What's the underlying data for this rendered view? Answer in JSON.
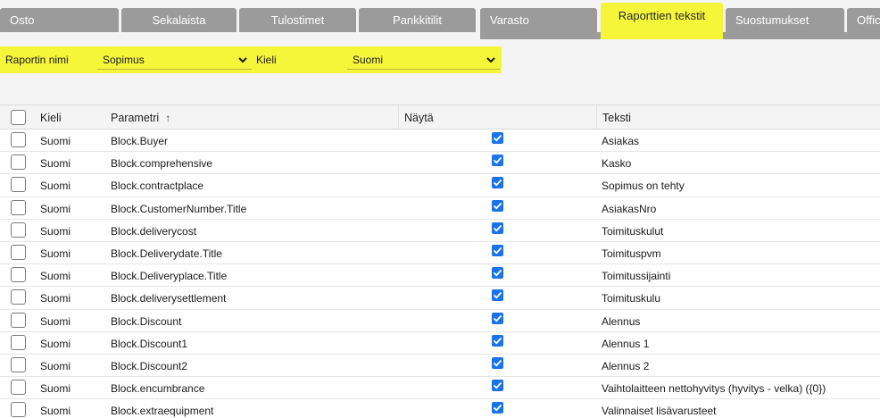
{
  "tabs": [
    {
      "label": "Osto",
      "active": false
    },
    {
      "label": "Sekalaista",
      "active": false
    },
    {
      "label": "Tulostimet",
      "active": false
    },
    {
      "label": "Pankkitilit",
      "active": false
    },
    {
      "label": "Varasto",
      "active": false
    },
    {
      "label": "Raporttien tekstit",
      "active": true
    },
    {
      "label": "Suostumukset",
      "active": false
    },
    {
      "label": "Offic",
      "active": false
    }
  ],
  "filters": {
    "report_label": "Raportin nimi",
    "report_value": "Sopimus",
    "language_label": "Kieli",
    "language_value": "Suomi"
  },
  "table": {
    "columns": {
      "language": "Kieli",
      "parameter": "Parametri",
      "sort_indicator": "↑",
      "show": "Näytä",
      "text": "Teksti"
    },
    "rows": [
      {
        "language": "Suomi",
        "parameter": "Block.Buyer",
        "show": true,
        "text": "Asiakas"
      },
      {
        "language": "Suomi",
        "parameter": "Block.comprehensive",
        "show": true,
        "text": "Kasko"
      },
      {
        "language": "Suomi",
        "parameter": "Block.contractplace",
        "show": true,
        "text": "Sopimus on tehty"
      },
      {
        "language": "Suomi",
        "parameter": "Block.CustomerNumber.Title",
        "show": true,
        "text": "AsiakasNro"
      },
      {
        "language": "Suomi",
        "parameter": "Block.deliverycost",
        "show": true,
        "text": "Toimituskulut"
      },
      {
        "language": "Suomi",
        "parameter": "Block.Deliverydate.Title",
        "show": true,
        "text": "Toimituspvm"
      },
      {
        "language": "Suomi",
        "parameter": "Block.Deliveryplace.Title",
        "show": true,
        "text": "Toimitussijainti"
      },
      {
        "language": "Suomi",
        "parameter": "Block.deliverysettlement",
        "show": true,
        "text": "Toimituskulu"
      },
      {
        "language": "Suomi",
        "parameter": "Block.Discount",
        "show": true,
        "text": "Alennus"
      },
      {
        "language": "Suomi",
        "parameter": "Block.Discount1",
        "show": true,
        "text": "Alennus 1"
      },
      {
        "language": "Suomi",
        "parameter": "Block.Discount2",
        "show": true,
        "text": "Alennus 2"
      },
      {
        "language": "Suomi",
        "parameter": "Block.encumbrance",
        "show": true,
        "text": "Vaihtolaitteen nettohyvitys (hyvitys - velka) ({0})"
      },
      {
        "language": "Suomi",
        "parameter": "Block.extraequipment",
        "show": true,
        "text": "Valinnaiset lisävarusteet"
      }
    ]
  },
  "colors": {
    "accent_yellow": "#f5f53a",
    "tab_gray": "#9b9b9b",
    "checkbox_blue": "#1a73e8"
  },
  "icons": {
    "dropdown": "chevron-down-icon",
    "row_check": "checkmark-icon"
  }
}
